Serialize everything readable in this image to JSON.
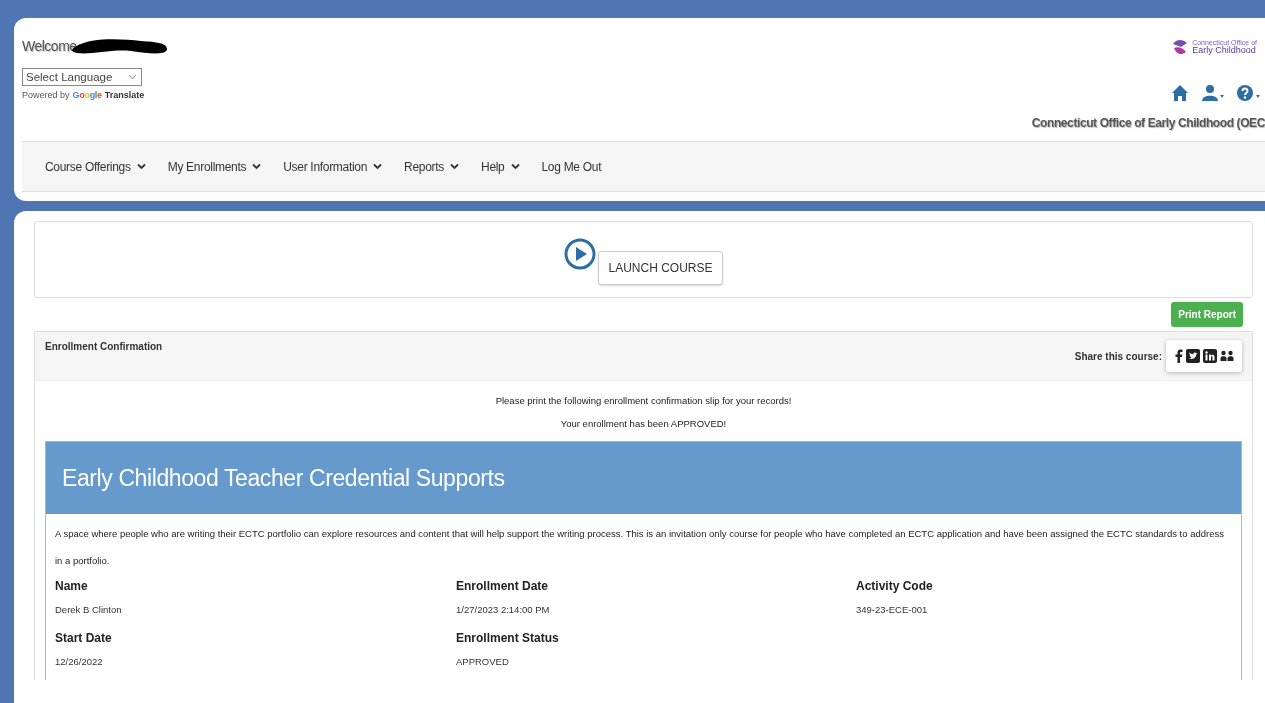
{
  "header": {
    "welcome": "Welcome",
    "language_select": {
      "value": "Select Language"
    },
    "powered_by": "Powered by",
    "google": "Google",
    "translate": "Translate",
    "logo_text": [
      "Connecticut Office of",
      "Early Childhood"
    ],
    "org_name": "Connecticut Office of Early Childhood (OEC"
  },
  "nav": [
    {
      "label": "Course Offerings",
      "dropdown": true
    },
    {
      "label": "My Enrollments",
      "dropdown": true
    },
    {
      "label": "User Information",
      "dropdown": true
    },
    {
      "label": "Reports",
      "dropdown": true
    },
    {
      "label": "Help",
      "dropdown": true
    },
    {
      "label": "Log Me Out",
      "dropdown": false
    }
  ],
  "launch_button": "LAUNCH COURSE",
  "print_button": "Print Report",
  "panel": {
    "title": "Enrollment Confirmation",
    "share_label": "Share this course:",
    "messages": [
      "Please print the following enrollment confirmation slip for your records!",
      "Your enrollment has been APPROVED!"
    ]
  },
  "course": {
    "title": "Early Childhood Teacher Credential Supports",
    "description": "A space where people who are writing their ECTC portfolio can explore resources and content that will help support the writing process. This is an invitation only course for people who have completed an ECTC application and have been assigned the ECTC standards to address in a portfolio.",
    "fields": [
      {
        "label": "Name",
        "value": "Derek B Clinton"
      },
      {
        "label": "Enrollment Date",
        "value": "1/27/2023 2:14:00 PM"
      },
      {
        "label": "Activity Code",
        "value": "349-23-ECE-001"
      },
      {
        "label": "Start Date",
        "value": "12/26/2022"
      },
      {
        "label": "Enrollment Status",
        "value": "APPROVED"
      }
    ]
  }
}
